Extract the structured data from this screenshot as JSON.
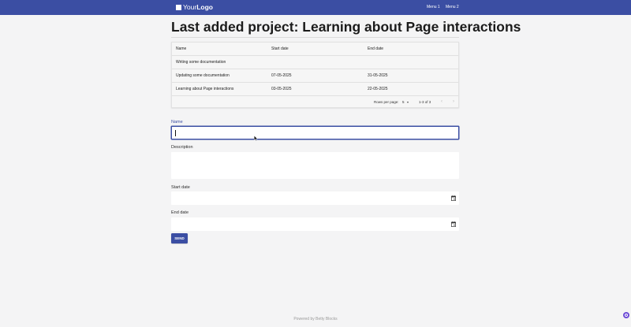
{
  "header": {
    "logo_prefix": "Your",
    "logo_suffix": "Logo",
    "menu": [
      "Menu 1",
      "Menu 2"
    ]
  },
  "page": {
    "title": "Last added project: Learning about Page interactions"
  },
  "table": {
    "columns": [
      "Name",
      "Start date",
      "End date"
    ],
    "rows": [
      [
        "Writing some documentation",
        "",
        ""
      ],
      [
        "Updating some documentation",
        "07-05-2025",
        "31-05-2025"
      ],
      [
        "Learning about Page interactions",
        "03-05-2025",
        "22-05-2025"
      ]
    ],
    "rows_per_page_label": "Rows per page:",
    "rows_per_page_value": "5",
    "range_text": "1-3 of 3"
  },
  "form": {
    "name_label": "Name",
    "name_value": "",
    "description_label": "Description",
    "description_value": "",
    "start_date_label": "Start date",
    "end_date_label": "End date",
    "submit_label": "SEND"
  },
  "footer": {
    "text": "Powered by Betty Blocks"
  },
  "colors": {
    "primary": "#3b4ea3",
    "background": "#f4f4f5",
    "chat_widget": "#6c4ad6"
  },
  "icons": [
    "calendar-icon",
    "calendar-icon",
    "chevron-left-icon",
    "chevron-right-icon",
    "caret-down-icon",
    "chat-icon"
  ]
}
